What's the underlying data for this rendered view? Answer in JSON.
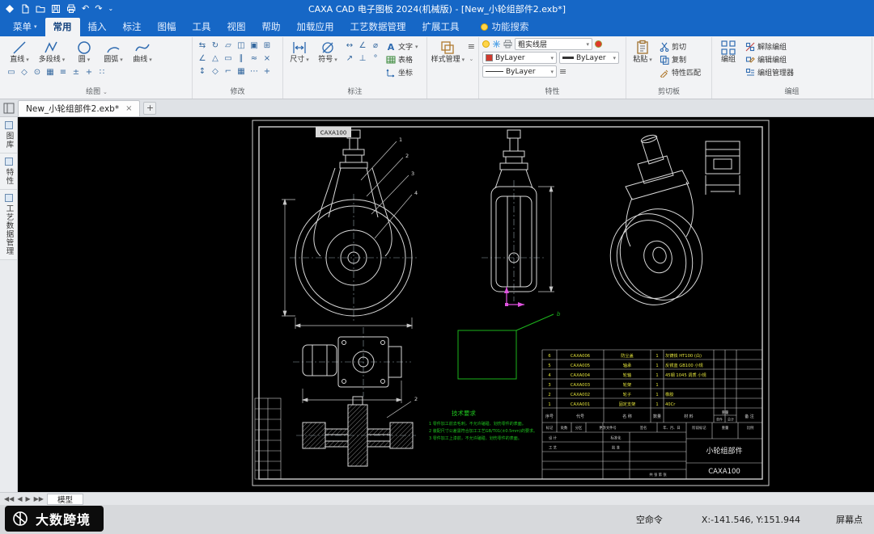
{
  "titlebar": {
    "title": "CAXA CAD 电子图板 2024(机械版) - [New_小轮组部件2.exb*]"
  },
  "menubar": {
    "menu_button": "菜单",
    "tabs": [
      "常用",
      "插入",
      "标注",
      "图幅",
      "工具",
      "视图",
      "帮助",
      "加载应用",
      "工艺数据管理",
      "扩展工具"
    ],
    "search_label": "功能搜索"
  },
  "ribbon": {
    "draw": {
      "label": "绘图",
      "tools": [
        "直线",
        "多段线",
        "圆",
        "圆弧",
        "曲线"
      ],
      "extra_icons": [
        "▭",
        "◇",
        "⊙",
        "▦",
        "≡",
        "±",
        "+",
        "∷"
      ]
    },
    "modify": {
      "label": "修改",
      "icons": [
        "⇆",
        "↻",
        "▱",
        "◫",
        "▣",
        "⊞",
        "∠",
        "△",
        "▭",
        "∥",
        "≈",
        "×",
        "↕",
        "◇",
        "⌐",
        "▦",
        "⋯",
        "+"
      ]
    },
    "annotate": {
      "label": "标注",
      "dimension": "尺寸",
      "symbol": "符号",
      "coordinate": "坐标",
      "text": "文字",
      "table": "表格",
      "icons": [
        "↔",
        "∠",
        "⌀",
        "↗",
        "⊥",
        "°"
      ]
    },
    "style": {
      "label": "样式管理"
    },
    "properties": {
      "label": "特性",
      "layer": "粗实线层",
      "color": "ByLayer",
      "linetype": "ByLayer",
      "lineweight": "ByLayer"
    },
    "clipboard": {
      "label": "剪切板",
      "paste": "粘贴",
      "cut": "剪切",
      "copy": "复制",
      "match": "特性匹配"
    },
    "group": {
      "label": "编组",
      "group_btn": "编组",
      "ungroup": "解除编组",
      "edit_group": "编辑编组",
      "group_manager": "编组管理器"
    }
  },
  "document_tabs": {
    "active": "New_小轮组部件2.exb*"
  },
  "side_panel": {
    "tabs": [
      "图库",
      "特性",
      "工艺数据管理"
    ]
  },
  "drawing": {
    "stamp": "CAXA100",
    "balloons": [
      "1",
      "2",
      "3",
      "4"
    ],
    "section_balloon": "2",
    "detail_balloon": "b",
    "notes_title": "技术要求",
    "notes": [
      "1 零件加工前去毛刺，不允许磕碰、划伤零件的表面。",
      "2 装配尺寸公差需符合加工工艺GB/T01(±0.5mm)的要求。",
      "3 零件加工上漆前，不允许磕碰、划伤零件的表面。"
    ],
    "parts_list": {
      "headers": {
        "seq": "序号",
        "code": "代号",
        "name": "名 称",
        "qty": "数量",
        "material": "材 料",
        "weight": "重量",
        "unit": "单件",
        "total": "总计",
        "note": "备 注"
      },
      "rows": [
        {
          "seq": "6",
          "code": "CAXA006",
          "name": "防尘盖",
          "qty": "1",
          "material": "灰铸铁 HT100 (白)"
        },
        {
          "seq": "5",
          "code": "CAXA005",
          "name": "轴承",
          "qty": "1",
          "material": "反锈蓝 GB100 小规"
        },
        {
          "seq": "4",
          "code": "CAXA004",
          "name": "轮轴",
          "qty": "1",
          "material": "45钢 1045 调质 小规"
        },
        {
          "seq": "3",
          "code": "CAXA003",
          "name": "轮架",
          "qty": "1",
          "material": "45钢 1045 调质 小规"
        },
        {
          "seq": "2",
          "code": "CAXA002",
          "name": "轮子",
          "qty": "1",
          "material": "橡胶"
        },
        {
          "seq": "1",
          "code": "CAXA001",
          "name": "固定支架",
          "qty": "1",
          "material": "40Cr"
        }
      ]
    },
    "title_block": {
      "part_name": "小轮组部件",
      "drawing_no": "CAXA100",
      "fields": {
        "mark": "标记",
        "count": "处数",
        "zone": "分区",
        "change_no": "更改文件号",
        "sign": "签名",
        "date": "年、月、日",
        "design": "设 计",
        "standard": "标准化",
        "craft": "工 艺",
        "approve": "批 准",
        "stage": "阶段标记",
        "weight": "重量",
        "scale": "比例",
        "sheet": "共 张 第 张"
      }
    }
  },
  "model_bar": {
    "tab": "模型"
  },
  "statusbar": {
    "command": "空命令",
    "coords": "X:-141.546, Y:151.944",
    "mode": "屏幕点"
  },
  "watermark": {
    "text": "大数跨境"
  }
}
